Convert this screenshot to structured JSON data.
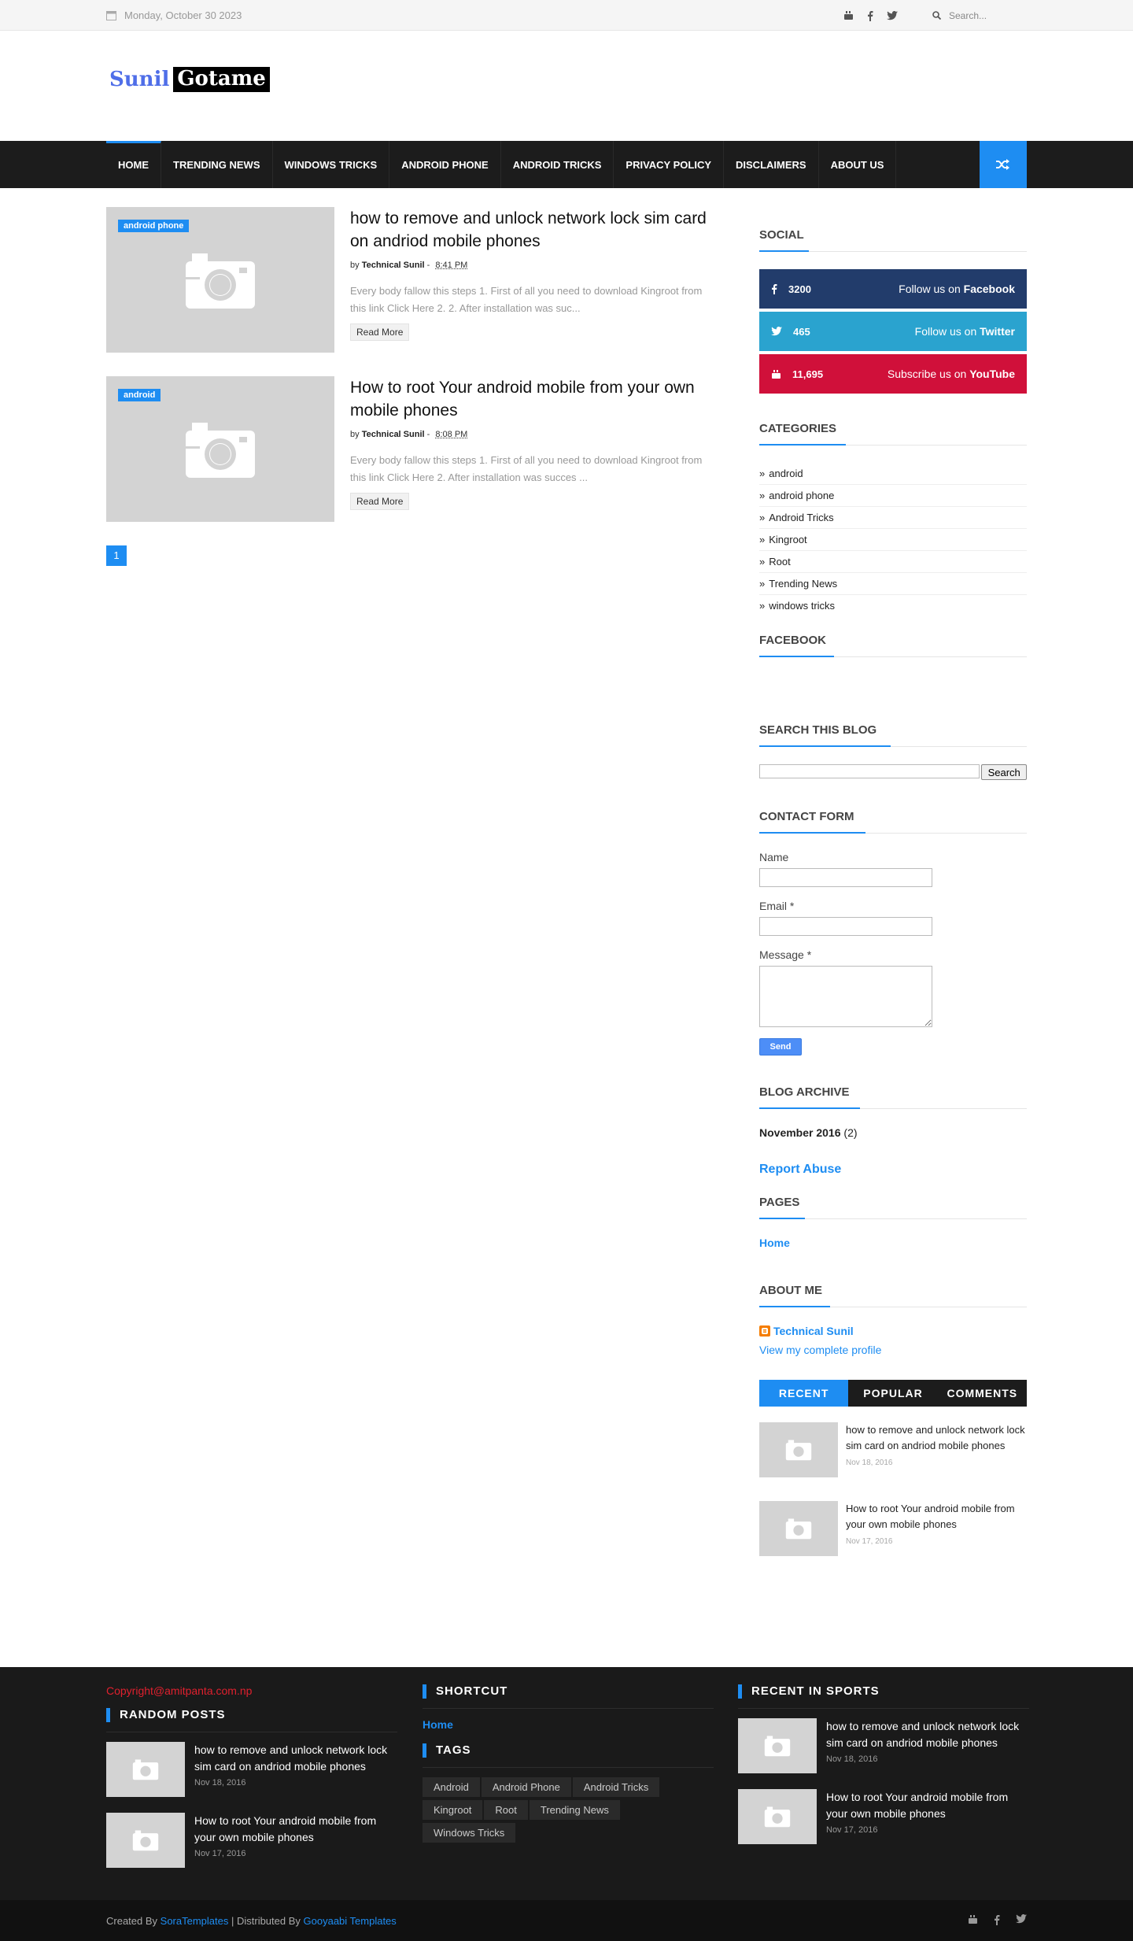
{
  "topbar": {
    "date": "Monday, October 30 2023",
    "search_placeholder": "Search..."
  },
  "logo": {
    "part1": "Sunil",
    "part2": "Gotame"
  },
  "nav": {
    "items": [
      "HOME",
      "TRENDING NEWS",
      "WINDOWS TRICKS",
      "ANDROID PHONE",
      "ANDROID TRICKS",
      "PRIVACY POLICY",
      "DISCLAIMERS",
      "ABOUT US"
    ]
  },
  "posts": [
    {
      "label": "android phone",
      "title": "how to remove and unlock network lock sim card on andriod mobile phones",
      "by": "by",
      "author": "Technical Sunil",
      "time": "8:41 PM",
      "snippet": "Every body fallow this steps 1. First of all you need to download  Kingroot  from this link  Click Here 2.  2. After installation was suc...",
      "read_more": "Read More"
    },
    {
      "label": "android",
      "title": "How to root Your android mobile from your own mobile phones",
      "by": "by",
      "author": "Technical Sunil",
      "time": "8:08 PM",
      "snippet": "Every body fallow this steps 1. First of all you need to download Kingroot from this link  Click Here 2. After installation was succes ...",
      "read_more": "Read More"
    }
  ],
  "pager": "1",
  "sidebar": {
    "social_title": "SOCIAL",
    "social": [
      {
        "count": "3200",
        "text": "Follow us on ",
        "network": "Facebook",
        "color": "#223c6b"
      },
      {
        "count": "465",
        "text": "Follow us on ",
        "network": "Twitter",
        "color": "#2aa3cf"
      },
      {
        "count": "11,695",
        "text": "Subscribe us on ",
        "network": "YouTube",
        "color": "#d0103a"
      }
    ],
    "categories_title": "CATEGORIES",
    "categories": [
      "android",
      "android phone",
      "Android Tricks",
      "Kingroot",
      "Root",
      "Trending News",
      "windows tricks"
    ],
    "facebook_title": "FACEBOOK",
    "search_title": "SEARCH THIS BLOG",
    "search_button": "Search",
    "contact_title": "CONTACT FORM",
    "contact_name": "Name",
    "contact_email": "Email *",
    "contact_message": "Message *",
    "contact_send": "Send",
    "archive_title": "BLOG ARCHIVE",
    "archive_month": "November 2016",
    "archive_count": "(2)",
    "report_abuse": "Report Abuse",
    "pages_title": "PAGES",
    "pages_home": "Home",
    "about_title": "ABOUT ME",
    "about_name": "Technical Sunil",
    "about_profile": "View my complete profile",
    "tabs": [
      "RECENT",
      "POPULAR",
      "COMMENTS"
    ],
    "recent": [
      {
        "title": "how to remove and unlock network lock sim card on andriod mobile phones",
        "date": "Nov 18, 2016"
      },
      {
        "title": "How to root Your android mobile from your own mobile phones",
        "date": "Nov 17, 2016"
      }
    ]
  },
  "footer": {
    "copyright": "Copyright@amitpanta.com.np",
    "random_title": "RANDOM POSTS",
    "random": [
      {
        "title": "how to remove and unlock network lock sim card on andriod mobile phones",
        "date": "Nov 18, 2016"
      },
      {
        "title": "How to root Your android mobile from your own mobile phones",
        "date": "Nov 17, 2016"
      }
    ],
    "shortcut_title": "SHORTCUT",
    "shortcut_home": "Home",
    "tags_title": "TAGS",
    "tags": [
      "Android",
      "Android Phone",
      "Android Tricks",
      "Kingroot",
      "Root",
      "Trending News",
      "Windows Tricks"
    ],
    "sports_title": "RECENT IN SPORTS",
    "sports": [
      {
        "title": "how to remove and unlock network lock sim card on andriod mobile phones",
        "date": "Nov 18, 2016"
      },
      {
        "title": "How to root Your android mobile from your own mobile phones",
        "date": "Nov 17, 2016"
      }
    ]
  },
  "bottom": {
    "created_by": "Created By ",
    "sora": "SoraTemplates",
    "distributed": " | Distributed By ",
    "gooyaabi": "Gooyaabi Templates"
  },
  "colors": {
    "accent": "#1e8df2",
    "dark": "#1c1c1c"
  }
}
